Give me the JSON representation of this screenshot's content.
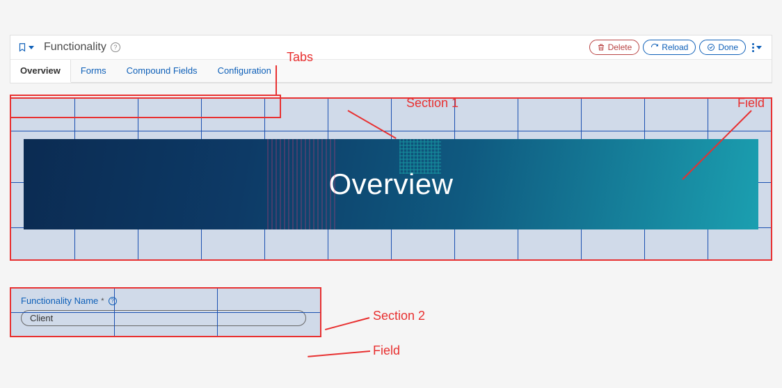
{
  "header": {
    "title": "Functionality",
    "buttons": {
      "delete": "Delete",
      "reload": "Reload",
      "done": "Done"
    }
  },
  "tabs": [
    {
      "label": "Overview",
      "active": true
    },
    {
      "label": "Forms",
      "active": false
    },
    {
      "label": "Compound Fields",
      "active": false
    },
    {
      "label": "Configuration",
      "active": false
    }
  ],
  "banner": {
    "title": "Overview"
  },
  "section2": {
    "field_label": "Functionality Name",
    "field_value": "Client",
    "required": true
  },
  "annotations": {
    "tabs": "Tabs",
    "section1": "Section 1",
    "section2": "Section 2",
    "field": "Field"
  }
}
